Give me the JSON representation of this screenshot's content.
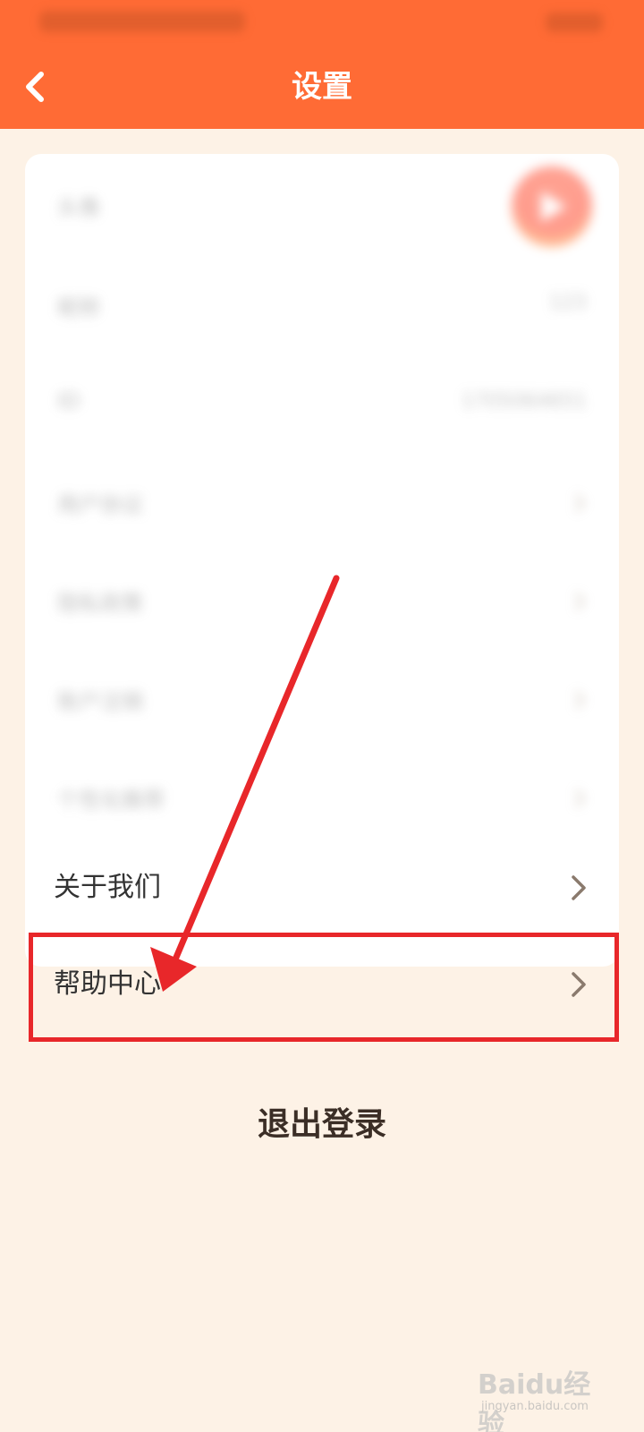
{
  "header": {
    "title": "设置",
    "back_icon": "chevron-left-icon",
    "background_color": "#ff6b35"
  },
  "settings_blurred": {
    "items": [
      {
        "label": "头像",
        "value": ""
      },
      {
        "label": "昵称",
        "value": "123"
      },
      {
        "label": "ID",
        "value": "1705064651"
      },
      {
        "label": "用户协议",
        "value": ""
      },
      {
        "label": "隐私政策",
        "value": ""
      },
      {
        "label": "账户注销",
        "value": ""
      },
      {
        "label": "个性化推荐",
        "value": ""
      }
    ]
  },
  "menu": {
    "about_label": "关于我们",
    "help_label": "帮助中心",
    "chevron_icon": "chevron-right-icon"
  },
  "logout": {
    "label": "退出登录"
  },
  "watermark": {
    "text": "Baidu经验",
    "url": "jingyan.baidu.com"
  },
  "colors": {
    "accent": "#ff6b35",
    "annotation": "#e8272a",
    "background": "#fdf2e6"
  }
}
